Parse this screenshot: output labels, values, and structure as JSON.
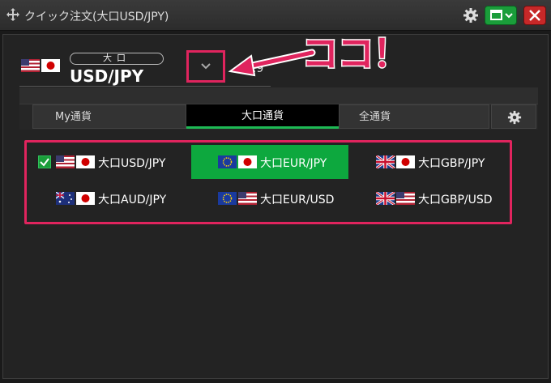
{
  "window": {
    "title": "クイック注文(大口USD/JPY)",
    "accent_green": "#1a9d3a",
    "close_red": "#c62828"
  },
  "header": {
    "lot_label": "大口",
    "pair": "USD/JPY",
    "partial_value": "1.9",
    "flag_icons": [
      "us-flag-icon",
      "jp-flag-icon"
    ]
  },
  "annotation": {
    "text": "ココ！",
    "color": "#e0245e"
  },
  "tabs": [
    {
      "label": "My通貨",
      "active": false
    },
    {
      "label": "大口通貨",
      "active": true
    },
    {
      "label": "全通貨",
      "active": false
    }
  ],
  "currencies": [
    {
      "label": "大口USD/JPY",
      "flags": [
        "us",
        "jp"
      ],
      "checked": true,
      "selected": false
    },
    {
      "label": "大口EUR/JPY",
      "flags": [
        "eu",
        "jp"
      ],
      "checked": false,
      "selected": true
    },
    {
      "label": "大口GBP/JPY",
      "flags": [
        "gb",
        "jp"
      ],
      "checked": false,
      "selected": false
    },
    {
      "label": "大口AUD/JPY",
      "flags": [
        "au",
        "jp"
      ],
      "checked": false,
      "selected": false
    },
    {
      "label": "大口EUR/USD",
      "flags": [
        "eu",
        "us"
      ],
      "checked": false,
      "selected": false
    },
    {
      "label": "大口GBP/USD",
      "flags": [
        "gb",
        "us"
      ],
      "checked": false,
      "selected": false
    }
  ]
}
